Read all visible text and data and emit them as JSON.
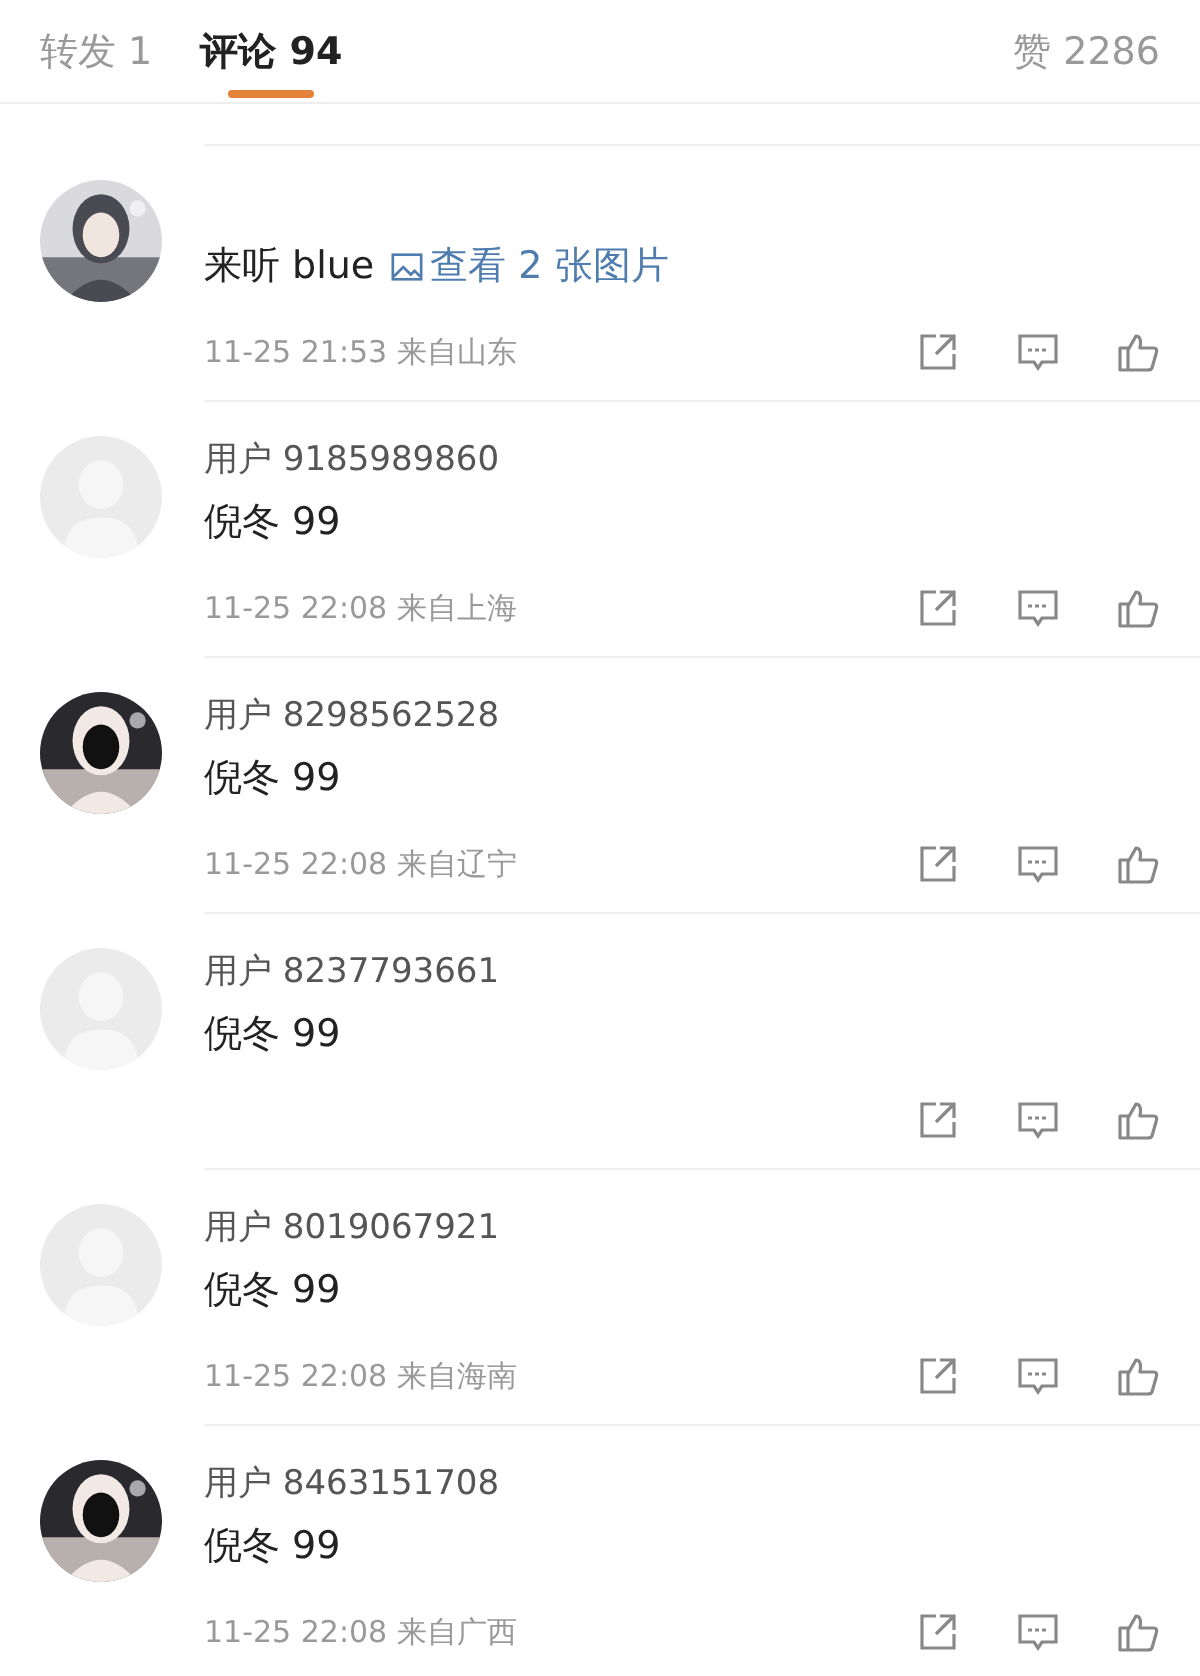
{
  "tabs": [
    {
      "label": "转发 1",
      "selected": false
    },
    {
      "label": "评论 94",
      "selected": true
    }
  ],
  "likes": "赞 2286",
  "comments": [
    {
      "kind": "picture",
      "text": "来听 blue",
      "link": "查看 2 张图片",
      "meta": "11-25 21:53 来自山东"
    },
    {
      "kind": "default",
      "user": "用户 9185989860",
      "text": "倪冬 99",
      "meta": "11-25 22:08 来自上海"
    },
    {
      "kind": "picture",
      "user": "用户 8298562528",
      "text": "倪冬 99",
      "meta": "11-25 22:08 来自辽宁"
    },
    {
      "kind": "default",
      "user": "用户 8237793661",
      "text": "倪冬 99"
    },
    {
      "kind": "default",
      "user": "用户 8019067921",
      "text": "倪冬 99",
      "meta": "11-25 22:08 来自海南"
    },
    {
      "kind": "picture",
      "user": "用户 8463151708",
      "text": "倪冬 99",
      "meta": "11-25 22:08 来自广西"
    }
  ]
}
